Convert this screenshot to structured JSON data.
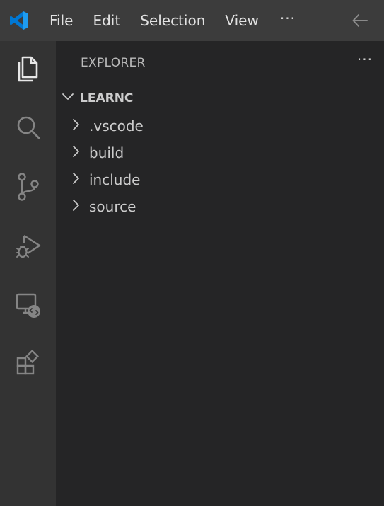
{
  "menu": {
    "items": [
      "File",
      "Edit",
      "Selection",
      "View"
    ],
    "more": "···"
  },
  "explorer": {
    "title": "EXPLORER",
    "more": "···",
    "folder": "LEARNC",
    "children": [
      ".vscode",
      "build",
      "include",
      "source"
    ]
  },
  "icons": {
    "logo": "vscode-logo",
    "activity": [
      "explorer-icon",
      "search-icon",
      "source-control-icon",
      "run-debug-icon",
      "remote-explorer-icon",
      "extensions-icon"
    ],
    "back": "arrow-left-icon"
  },
  "colors": {
    "accent": "#0098ff",
    "titlebar": "#3c3c3c",
    "activitybar": "#333333",
    "sidebar": "#252526"
  }
}
